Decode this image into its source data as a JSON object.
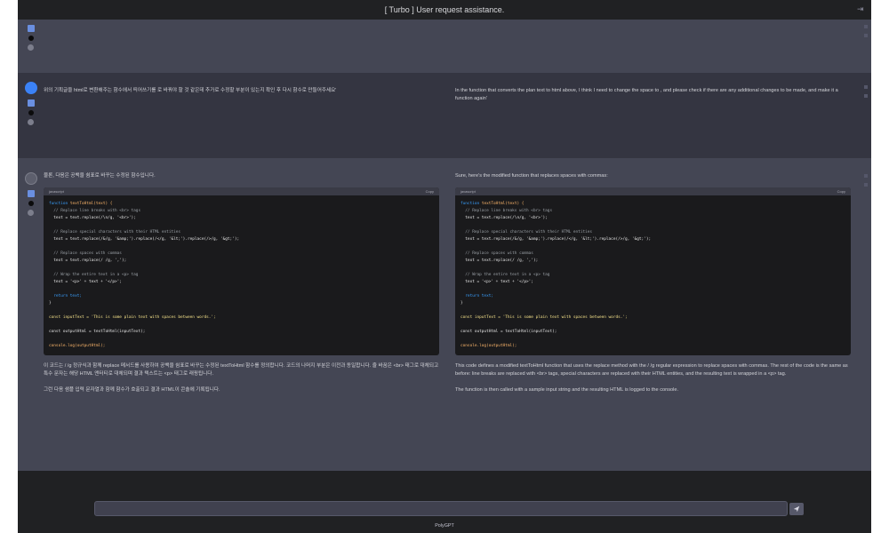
{
  "app": {
    "title": "[ Turbo ] User request assistance.",
    "footer": "PolyGPT"
  },
  "icons": {
    "copy": "copy-icon",
    "collapse": "sidebar-collapse-icon",
    "send": "send-icon"
  },
  "colors": {
    "accent_user_avatar": "#3b82f6",
    "bg_main": "#343541",
    "bg_assistant": "#444654",
    "bg_top": "#202123"
  },
  "messages": {
    "user": {
      "left": "위의 기획글을 html로 변환해주는 함수에서 띄어쓰기를 로 바꿔야 할 것 같은데 추가로 수정할 부분이 있는지 확인 후 다시 함수로 만들어주세요'",
      "right": "In the function that converts the plan text to html above, I think I need to change the space to , and please check if there are any additional changes to be made, and make it a function again'"
    },
    "assistant": {
      "left_intro": "물론, 다음은 공백을 쉼표로 바꾸는 수정된 함수입니다.",
      "right_intro": "Sure, here's the modified function that replaces spaces with commas:",
      "code_lang": "javascript",
      "copy_label": "Copy",
      "code_lines": [
        "function textToHtml(text) {",
        "  // Replace line breaks with <br> tags",
        "  text = text.replace(/\\n/g, '<br>');",
        "",
        "  // Replace special characters with their HTML entities",
        "  text = text.replace(/&/g, '&amp;').replace(/</g, '&lt;').replace(/>/g, '&gt;');",
        "",
        "  // Replace spaces with commas",
        "  text = text.replace(/ /g, ',');",
        "",
        "  // Wrap the entire text in a <p> tag",
        "  text = '<p>' + text + '</p>';",
        "",
        "  return text;",
        "}",
        "",
        "const inputText = 'This is some plain text with spaces between words.';",
        "",
        "const outputHtml = textToHtml(inputText);",
        "",
        "console.log(outputHtml);"
      ],
      "left_para1": "이 코드는 / /g 정규식과 함께 replace 메서드를 사용하여 공백을 쉼표로 바꾸는 수정된 textToHtml 함수를 정의합니다. 코드의 나머지 부분은 이전과 동일합니다. 줄 바꿈은 <br> 태그로 대체되고 특수 문자는 해당 HTML 엔터티로 대체되며 결과 텍스트는 <p> 태그로 래핑됩니다.",
      "left_para2": "그런 다음 샘플 입력 문자열과 함께 함수가 호출되고 결과 HTML이 콘솔에 기록됩니다.",
      "right_para1": "This code defines a modified textToHtml function that uses the replace method with the / /g regular expression to replace spaces with commas. The rest of the code is the same as before: line breaks are replaced with <br> tags, special characters are replaced with their HTML entities, and the resulting text is wrapped in a <p> tag.",
      "right_para2": "The function is then called with a sample input string and the resulting HTML is logged to the console."
    }
  },
  "input": {
    "placeholder": ""
  }
}
